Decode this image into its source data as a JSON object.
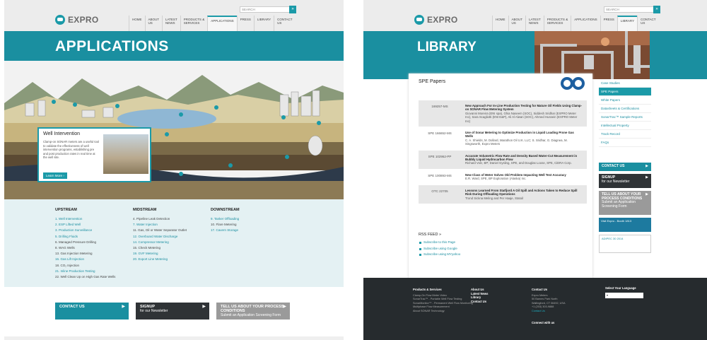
{
  "page1": {
    "logo": "EXPRO",
    "search_placeholder": "SEARCH",
    "nav": [
      "HOME",
      "ABOUT\nUS",
      "LATEST\nNEWS",
      "PRODUCTS &\nSERVICES",
      "APPLICATIONS",
      "PRESS",
      "LIBRARY",
      "CONTACT\nUS"
    ],
    "active_nav": "APPLICATIONS",
    "banner_title": "APPLICATIONS",
    "card": {
      "title": "Well Intervention",
      "text": "Clamp-on SONAR meters are a useful tool to validate the effectiveness of well intervention programs, establishing pre and post production rates in real time at the well site.",
      "button": "Learn More ›"
    },
    "lists": {
      "upstream": {
        "title": "UPSTREAM",
        "items": [
          {
            "t": "1. Well Intervention",
            "link": true
          },
          {
            "t": "2. ESP Lifted Well",
            "link": true
          },
          {
            "t": "3. Production Surveillance",
            "link": true
          },
          {
            "t": "5. Drilling Fluids",
            "link": true
          },
          {
            "t": "6. Managed Pressure Drilling",
            "link": false
          },
          {
            "t": "8. WAG Wells",
            "link": false
          },
          {
            "t": "13. Gas Injection Metering",
            "link": false
          },
          {
            "t": "16. Gas Lift Injection",
            "link": true
          },
          {
            "t": "18. CO₂ Injection",
            "link": false
          },
          {
            "t": "21. Inline Production Testing",
            "link": true
          },
          {
            "t": "22. Well Clean Up on High Gas Rate Wells",
            "link": false
          }
        ]
      },
      "midstream": {
        "title": "MIDSTREAM",
        "items": [
          {
            "t": "4. Pipeline Leak Detection",
            "link": false
          },
          {
            "t": "7. Water Injection",
            "link": true
          },
          {
            "t": "11. Gas, Oil or Water Separator Outlet",
            "link": false
          },
          {
            "t": "12. Overboard Water Discharge",
            "link": true
          },
          {
            "t": "14. Compressor Metering",
            "link": true
          },
          {
            "t": "15. Check Metering",
            "link": false
          },
          {
            "t": "19. GVF Metering",
            "link": true
          },
          {
            "t": "20. Export Line Metering",
            "link": true
          }
        ]
      },
      "downstream": {
        "title": "DOWNSTREAM",
        "items": [
          {
            "t": "9. Tanker Offloading",
            "link": true
          },
          {
            "t": "10. Flare Metering",
            "link": false
          },
          {
            "t": "17. Cavern Storage",
            "link": true
          }
        ]
      }
    },
    "cta": {
      "contact": "CONTACT US",
      "signup_title": "SIGNUP",
      "signup_sub": "for our Newsletter",
      "tell_title": "TELL US ABOUT YOUR PROCESS CONDITIONS",
      "tell_sub": "Submit an Application Screening Form"
    },
    "colors": {
      "teal": "#1a8fa0",
      "dark": "#2f3336",
      "grey": "#9a9a9a"
    }
  },
  "page2": {
    "logo": "EXPRO",
    "search_placeholder": "SEARCH",
    "nav": [
      "HOME",
      "ABOUT\nUS",
      "LATEST\nNEWS",
      "PRODUCTS &\nSERVICES",
      "APPLICATIONS",
      "PRESS",
      "LIBRARY",
      "CONTACT\nUS"
    ],
    "active_nav": "LIBRARY",
    "banner_title": "LIBRARY",
    "section_title": "SPE Papers",
    "papers": [
      {
        "code": "169257-MS",
        "title": "New Approach For In-Line Production Testing for Mature Oil Fields Using Clamp-on SONAR Flow Metering System",
        "authors": "Giovanni Moreira (ENI spa), Ghia Naseem (SOC), Siddesh Sridhar (EXPRO Meter Inc), Sara Scagliotti (ENI E&P), Ali Al Alwan (SOC), Ahmed Hussein (EXPRO Meter Inc)"
      },
      {
        "code": "SPE 166652-MS",
        "title": "Use of Sonar Metering to Optimize Production in Liquid Loading Prone Gas Wells",
        "authors": "C. A. Shields, M. Dollard, Marathon Oil U.K. LLC; S. Sridhar, G. Diagnea, M. Singsworth, Expro Meters"
      },
      {
        "code": "SPE 102962-PP",
        "title": "Accurate Volumetric Flow Rate and Density Based Water-Cut Measurement in Bubbly Liquid Hydrocarbon Flow",
        "authors": "Richard Volz, BP; Daniel Gysling, SPE, and Douglas Loose, SPE, CiDRA Corp."
      },
      {
        "code": "SPE 100893-MS",
        "title": "New Class of Meter Solves Old Problem Impacting Well Test Accuracy",
        "authors": "E.R. Ward, SPE, BP Exploration (Alaska) Inc."
      },
      {
        "code": "OTC 22705",
        "title": "Lessons Learned From Statfjord A Oil Spill and Actions Taken to Reduce Spill Risk During Offloading Operations",
        "authors": "Trond Sickna Meling and Per Haaje, Statoil"
      }
    ],
    "rss": {
      "title": "RSS FEED »",
      "items": [
        "Subscribe to this Page",
        "Subscribe using Google",
        "Subscribe using MYyahoo"
      ]
    },
    "sidebar": [
      "Case Studies",
      "SPE Papers",
      "White Papers",
      "Datasheets & Certifications",
      "SonarTrac™ Sample Reports",
      "Intellectual Property",
      "Track Record",
      "FAQs"
    ],
    "active_side": "SPE Papers",
    "side_cta": {
      "contact": "CONTACT US",
      "signup_title": "SIGNUP",
      "signup_sub": "for our Newsletter",
      "tell_title": "TELL US ABOUT YOUR PROCESS CONDITIONS",
      "tell_sub": "Submit an Application Screening Form"
    },
    "ads": {
      "ad1": "Visit Expro - Booth 1813",
      "ad2": "ADIPEC 30 2014"
    },
    "footer": {
      "products_title": "Products & Services",
      "products": [
        "Clamp-On Flow Meter Video",
        "SonarTrac™ - Portable Well Flow Testing",
        "SonarMonitor™ - Permanent Well Flow Monitoring",
        "Multiphase Flow Measurement",
        "About SONAR Technology"
      ],
      "links": [
        "About Us",
        "Latest News",
        "Library",
        "Contact Us"
      ],
      "contact_title": "Contact Us",
      "contact": [
        "Expro Meters",
        "50 Barnes Park North",
        "Wallingford, CT 06492, USA",
        "+1 (203) 303-9888"
      ],
      "contact_link": "Contact Us",
      "connect": "Connect with us",
      "lang_title": "Select Your Language"
    }
  }
}
